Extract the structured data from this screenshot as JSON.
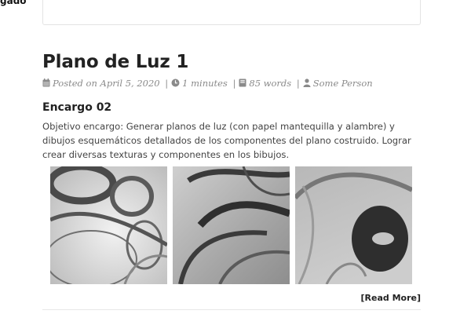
{
  "page": {
    "top_fragment": "gado"
  },
  "post": {
    "title": "Plano de Luz 1",
    "meta": {
      "posted_on": "Posted on April 5, 2020",
      "read_time": "1 minutes",
      "word_count": "85 words",
      "author": "Some Person"
    },
    "section_heading": "Encargo 02",
    "summary": "Objetivo encargo: Generar planos de luz (con papel mantequilla y alambre) y dibujos esquemáticos detallados de los componentes del plano costruido. Lograr crear diversas texturas y componentes en los bibujos.",
    "gallery": [
      {
        "name": "photo-1"
      },
      {
        "name": "photo-2"
      },
      {
        "name": "photo-3"
      }
    ],
    "read_more": "[Read More]"
  },
  "icons": {
    "calendar": "calendar-icon",
    "clock": "clock-icon",
    "book": "book-icon",
    "user": "user-icon"
  }
}
